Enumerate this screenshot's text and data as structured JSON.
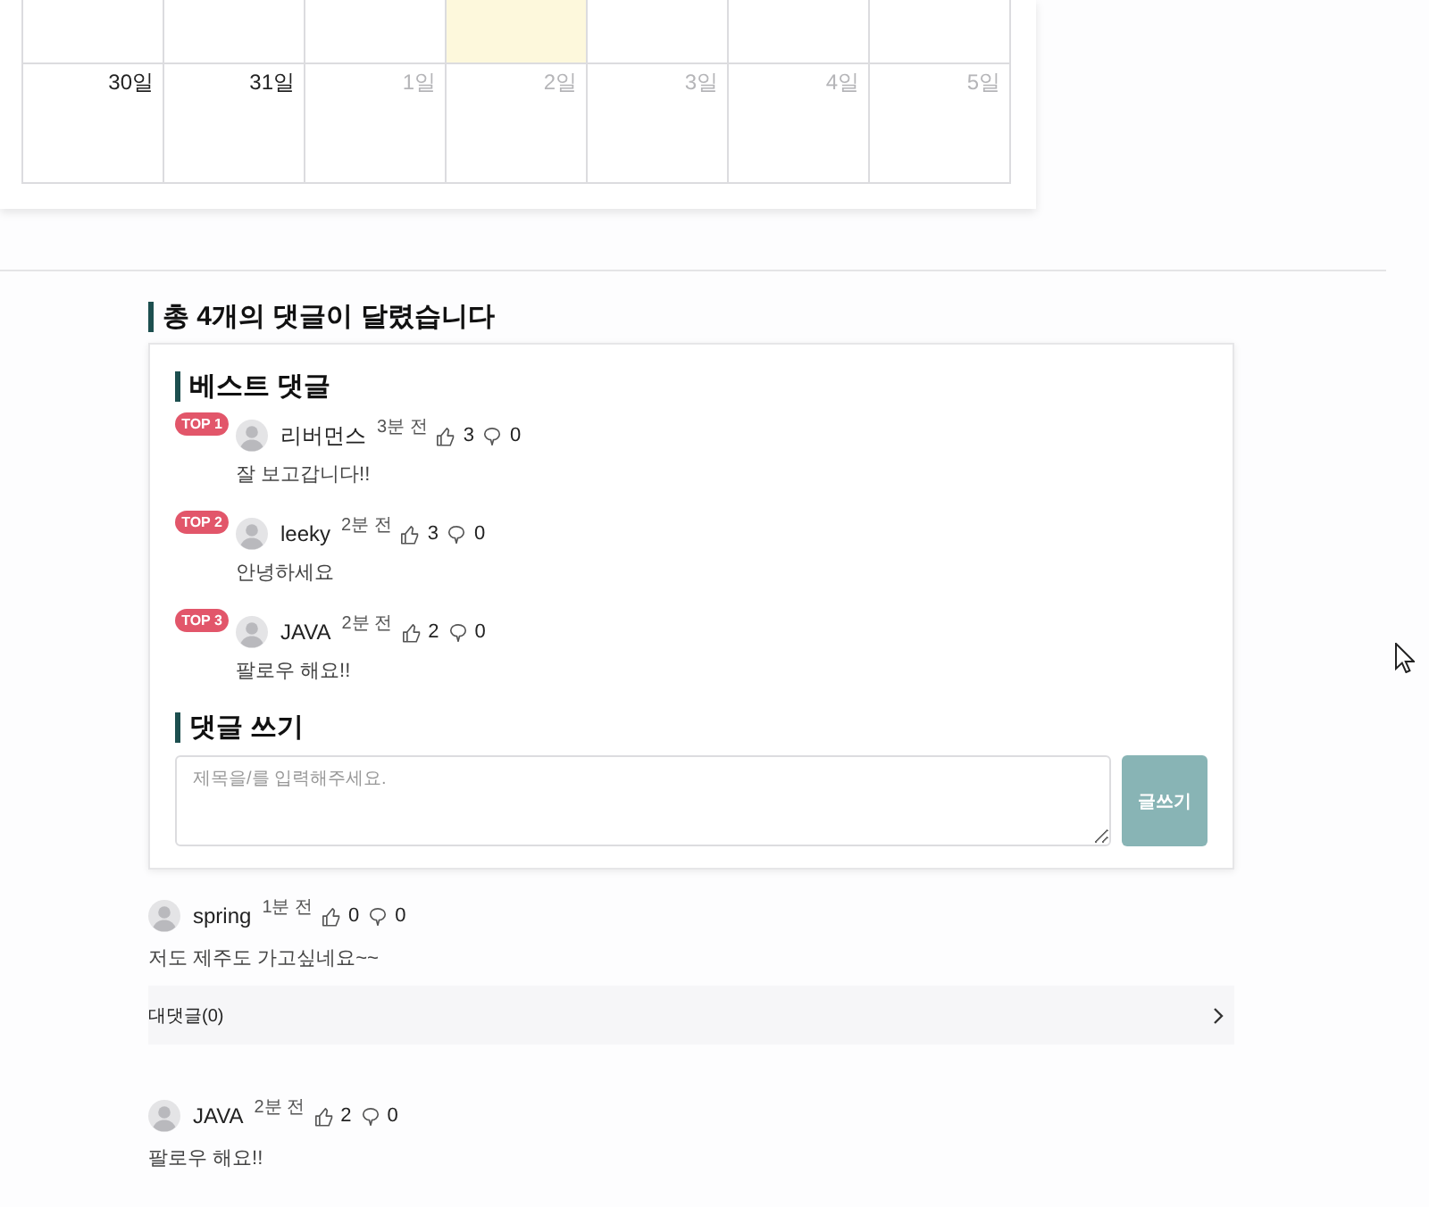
{
  "calendar": {
    "weeks": [
      {
        "days": [
          {
            "today": false
          },
          {
            "today": false
          },
          {
            "today": false
          },
          {
            "today": true
          },
          {
            "today": false
          },
          {
            "today": false
          },
          {
            "today": false
          }
        ]
      },
      {
        "days": [
          {
            "label": "30일",
            "other_month": false,
            "today": false
          },
          {
            "label": "31일",
            "other_month": false,
            "today": false
          },
          {
            "label": "1일",
            "other_month": true,
            "today": false
          },
          {
            "label": "2일",
            "other_month": true,
            "today": false
          },
          {
            "label": "3일",
            "other_month": true,
            "today": false
          },
          {
            "label": "4일",
            "other_month": true,
            "today": false
          },
          {
            "label": "5일",
            "other_month": true,
            "today": false
          }
        ]
      }
    ]
  },
  "comments_section": {
    "title": "총 4개의 댓글이 달렸습니다",
    "best": {
      "title": "베스트 댓글",
      "items": [
        {
          "rank": "TOP 1",
          "author": "리버먼스",
          "time": "3분 전",
          "likes": "3",
          "dislikes": "0",
          "text": "잘 보고갑니다!!"
        },
        {
          "rank": "TOP 2",
          "author": "leeky",
          "time": "2분 전",
          "likes": "3",
          "dislikes": "0",
          "text": "안녕하세요"
        },
        {
          "rank": "TOP 3",
          "author": "JAVA",
          "time": "2분 전",
          "likes": "2",
          "dislikes": "0",
          "text": "팔로우 해요!!"
        }
      ]
    },
    "write": {
      "title": "댓글 쓰기",
      "placeholder": "제목을/를 입력해주세요.",
      "submit": "글쓰기"
    },
    "comments": [
      {
        "author": "spring",
        "time": "1분 전",
        "likes": "0",
        "dislikes": "0",
        "text": "저도 제주도 가고싶네요~~",
        "replies": "대댓글(0)"
      },
      {
        "author": "JAVA",
        "time": "2분 전",
        "likes": "2",
        "dislikes": "0",
        "text": "팔로우 해요!!"
      }
    ]
  }
}
